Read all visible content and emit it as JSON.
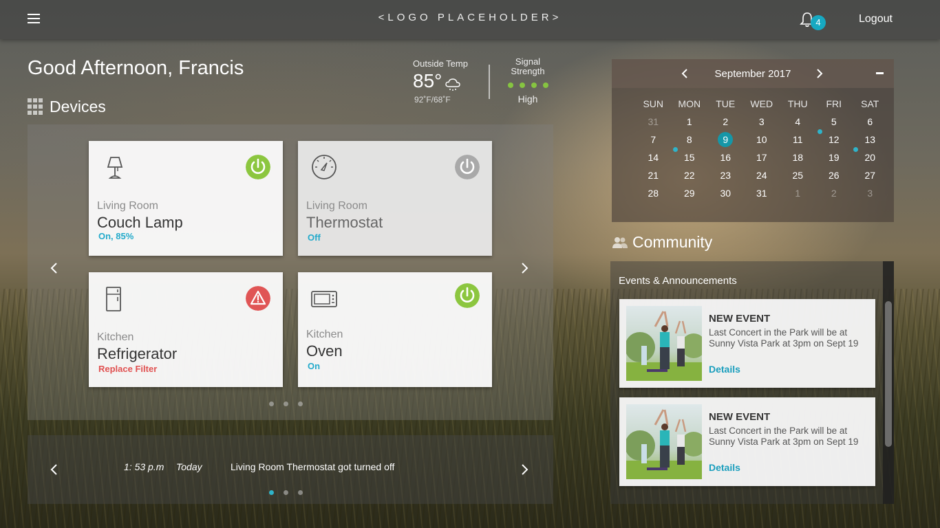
{
  "header": {
    "logo": "<LOGO PLACEHOLDER>",
    "notification_count": "4",
    "logout_label": "Logout"
  },
  "greeting": "Good Afternoon, Francis",
  "weather": {
    "label": "Outside Temp",
    "temp": "85°",
    "range": "92˚F/68˚F"
  },
  "signal": {
    "label": "Signal Strength",
    "level": "High"
  },
  "devices": {
    "title": "Devices",
    "cards": [
      {
        "room": "Living Room",
        "name": "Couch Lamp",
        "status": "On, 85%",
        "icon": "lamp-icon",
        "power_color": "#8cc63f"
      },
      {
        "room": "Living Room",
        "name": "Thermostat",
        "status": "Off",
        "icon": "thermostat-icon",
        "power_color": "#a9a9a9"
      },
      {
        "room": "Kitchen",
        "name": "Refrigerator",
        "status": "Replace Filter",
        "icon": "refrigerator-icon",
        "power_color": "#e05555"
      },
      {
        "room": "Kitchen",
        "name": "Oven",
        "status": "On",
        "icon": "oven-icon",
        "power_color": "#8cc63f"
      }
    ]
  },
  "activity": {
    "time": "1: 53 p.m",
    "day": "Today",
    "message": "Living Room Thermostat got turned off"
  },
  "calendar": {
    "month": "September 2017",
    "days_of_week": [
      "SUN",
      "MON",
      "TUE",
      "WED",
      "THU",
      "FRI",
      "SAT"
    ],
    "weeks": [
      [
        "31",
        "1",
        "2",
        "3",
        "4",
        "5",
        "6"
      ],
      [
        "7",
        "8",
        "9",
        "10",
        "11",
        "12",
        "13"
      ],
      [
        "14",
        "15",
        "16",
        "17",
        "18",
        "19",
        "20"
      ],
      [
        "21",
        "22",
        "23",
        "24",
        "25",
        "26",
        "27"
      ],
      [
        "28",
        "29",
        "30",
        "31",
        "1",
        "2",
        "3"
      ]
    ],
    "selected_day": "9",
    "accent_color": "#1597a8"
  },
  "community": {
    "title": "Community",
    "subtitle": "Events & Announcements",
    "events": [
      {
        "title": "NEW EVENT",
        "text": "Last Concert in the Park will be at Sunny Vista Park at 3pm on Sept 19",
        "link": "Details"
      },
      {
        "title": "NEW EVENT",
        "text": "Last Concert in the Park will be at Sunny Vista Park at 3pm on Sept 19",
        "link": "Details"
      }
    ]
  }
}
